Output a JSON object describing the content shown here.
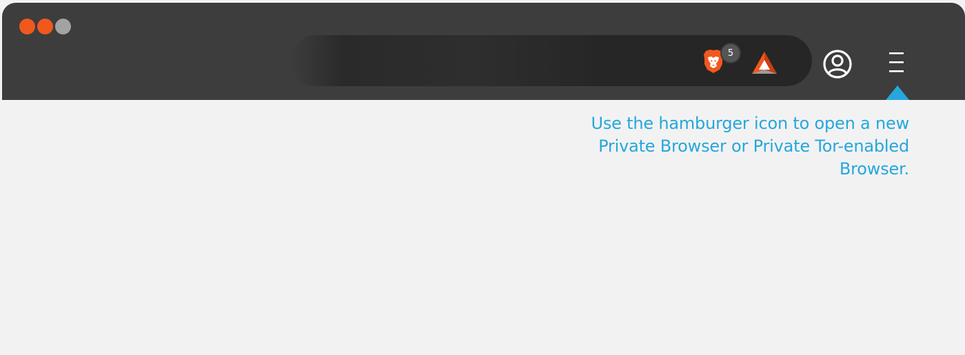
{
  "window": {
    "traffic_lights": [
      "#f1581e",
      "#f1581e",
      "#a3a3a3"
    ],
    "frame_color": "#3d3d3d"
  },
  "toolbar": {
    "shields": {
      "icon": "brave-lion-icon",
      "count": "5",
      "color": "#f1581e"
    },
    "rewards": {
      "icon": "rewards-triangle-icon",
      "color": "#f1581e"
    },
    "account": {
      "icon": "account-icon"
    },
    "menu": {
      "icon": "hamburger-menu-icon"
    }
  },
  "callout": {
    "text": "Use the hamburger icon to open a new Private Browser or Private Tor-enabled Browser.",
    "color": "#25a7dc"
  }
}
